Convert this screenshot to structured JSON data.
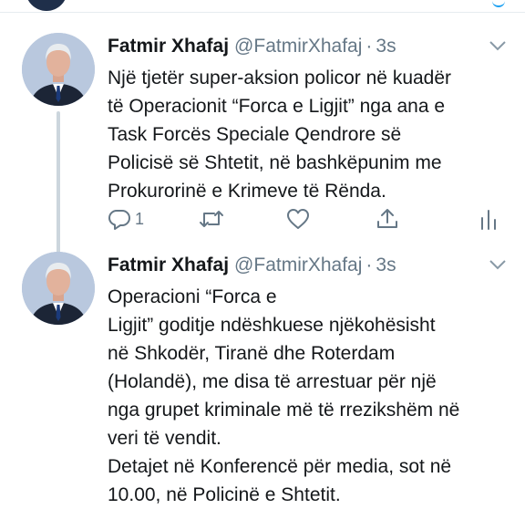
{
  "tweets": [
    {
      "display_name": "Fatmir Xhafaj",
      "handle": "@FatmirXhafaj",
      "separator": "·",
      "time": "3s",
      "text": "Një tjetër super-aksion policor në kuadër\ntë Operacionit “Forca e Ligjit” nga ana e\nTask Forcës Speciale Qendrore së\nPolicisë së Shtetit, në bashkëpunim me\nProkurorinë e Krimeve të Rënda.",
      "reply_count": "1",
      "icons": [
        "reply-icon",
        "retweet-icon",
        "like-icon",
        "share-icon",
        "analytics-icon",
        "chevron-down-icon"
      ]
    },
    {
      "display_name": "Fatmir Xhafaj",
      "handle": "@FatmirXhafaj",
      "separator": "·",
      "time": "3s",
      "text": "Operacioni “Forca e\nLigjit” goditje ndëshkuese njëkohësisht\nnë Shkodër, Tiranë dhe Roterdam\n(Holandë), me disa të arrestuar për një\nnga grupet kriminale më të rrezikshëm në\nveri të vendit.\nDetajet në Konferencë për media, sot në\n10.00, në Policinë e Shtetit.",
      "icons": [
        "chevron-down-icon"
      ]
    }
  ],
  "colors": {
    "text": "#14171a",
    "secondary": "#657786",
    "thread_line": "#ccd6dd",
    "accent": "#1da1f2"
  }
}
